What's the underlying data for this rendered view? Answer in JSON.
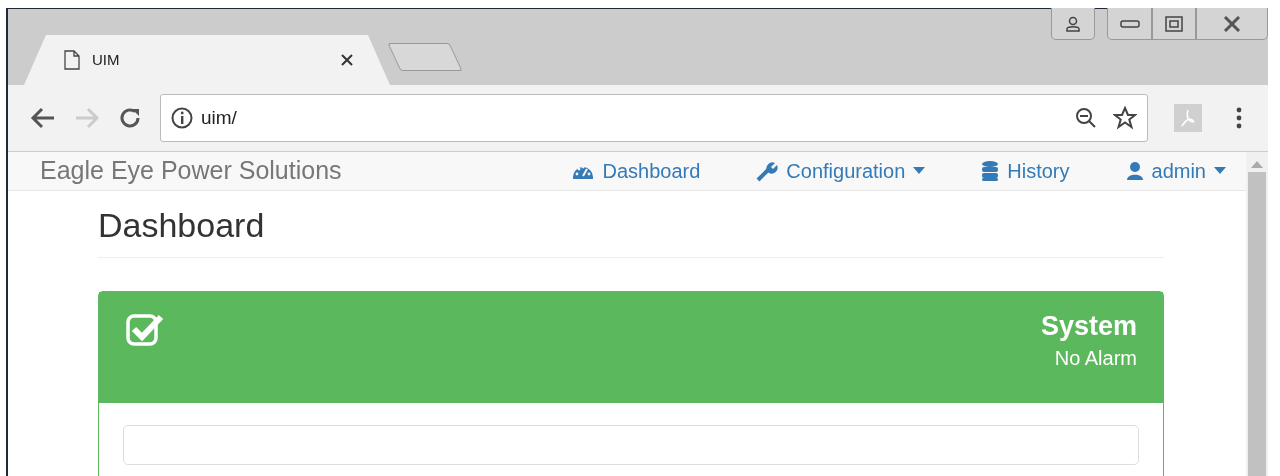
{
  "browser": {
    "tab": {
      "title": "UIM",
      "selected": true
    },
    "address": "uim/"
  },
  "navbar": {
    "brand": "Eagle Eye Power Solutions",
    "items": [
      {
        "label": "Dashboard",
        "kind": "gauge",
        "dropdown": false
      },
      {
        "label": "Configuration",
        "kind": "wrench",
        "dropdown": true
      },
      {
        "label": "History",
        "kind": "database",
        "dropdown": false
      },
      {
        "label": "admin",
        "kind": "user",
        "dropdown": true
      }
    ]
  },
  "page": {
    "heading": "Dashboard"
  },
  "panel": {
    "alarm": false,
    "title": "System",
    "subtitle": "No Alarm"
  }
}
